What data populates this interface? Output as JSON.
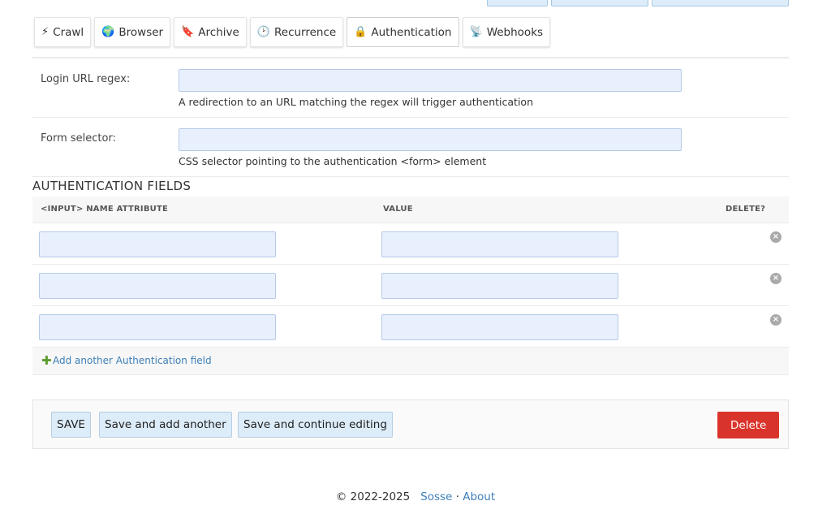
{
  "tabs": [
    {
      "icon": "⚡",
      "label": "Crawl"
    },
    {
      "icon": "🌍",
      "label": "Browser"
    },
    {
      "icon": "🔖",
      "label": "Archive"
    },
    {
      "icon": "🕑",
      "label": "Recurrence"
    },
    {
      "icon": "🔒",
      "label": "Authentication"
    },
    {
      "icon": "📡",
      "label": "Webhooks"
    }
  ],
  "active_tab": "Authentication",
  "login_url": {
    "label": "Login URL regex:",
    "value": "",
    "help": "A redirection to an URL matching the regex will trigger authentication"
  },
  "form_selector": {
    "label": "Form selector:",
    "value": "",
    "help": "CSS selector pointing to the authentication <form> element"
  },
  "auth_fields": {
    "title": "AUTHENTICATION FIELDS",
    "headers": {
      "name": "<INPUT> NAME ATTRIBUTE",
      "value": "VALUE",
      "delete": "DELETE?"
    },
    "rows": [
      {
        "name": "",
        "value": ""
      },
      {
        "name": "",
        "value": ""
      },
      {
        "name": "",
        "value": ""
      }
    ],
    "add_label": "Add another Authentication field"
  },
  "submit": {
    "save": "SAVE",
    "save_add": "Save and add another",
    "save_continue": "Save and continue editing",
    "delete": "Delete"
  },
  "footer": {
    "copyright": "© 2022-2025",
    "link1": "Sosse",
    "sep": "·",
    "link2": "About"
  },
  "colors": {
    "input_bg": "#e8f0fe",
    "button_bg": "#dcecf9",
    "delete_bg": "#d9342b",
    "link": "#3d7fb8"
  }
}
